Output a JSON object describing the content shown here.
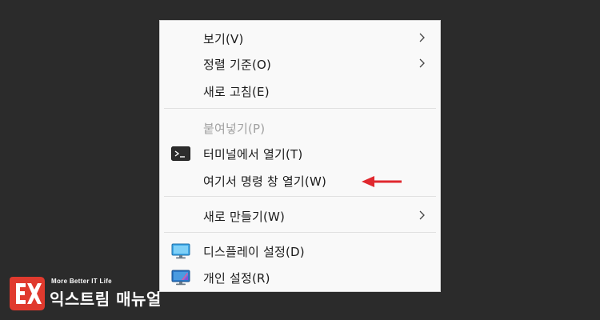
{
  "menu": {
    "items": [
      {
        "label": "보기(V)",
        "submenu": true
      },
      {
        "label": "정렬 기준(O)",
        "submenu": true
      },
      {
        "label": "새로 고침(E)"
      },
      {
        "label": "붙여넣기(P)",
        "disabled": true
      },
      {
        "label": "터미널에서 열기(T)",
        "icon": "terminal-icon"
      },
      {
        "label": "여기서 명령 창 열기(W)"
      },
      {
        "label": "새로 만들기(W)",
        "submenu": true
      },
      {
        "label": "디스플레이 설정(D)",
        "icon": "display-monitor-icon"
      },
      {
        "label": "개인 설정(R)",
        "icon": "personalize-monitor-icon"
      }
    ]
  },
  "annotation": {
    "arrow_color": "#e0282e",
    "target": "여기서 명령 창 열기(W)"
  },
  "logo": {
    "tagline": "More Better IT Life",
    "name": "익스트림 매뉴얼",
    "badge_letter": "X",
    "badge_color": "#e03a2e"
  }
}
